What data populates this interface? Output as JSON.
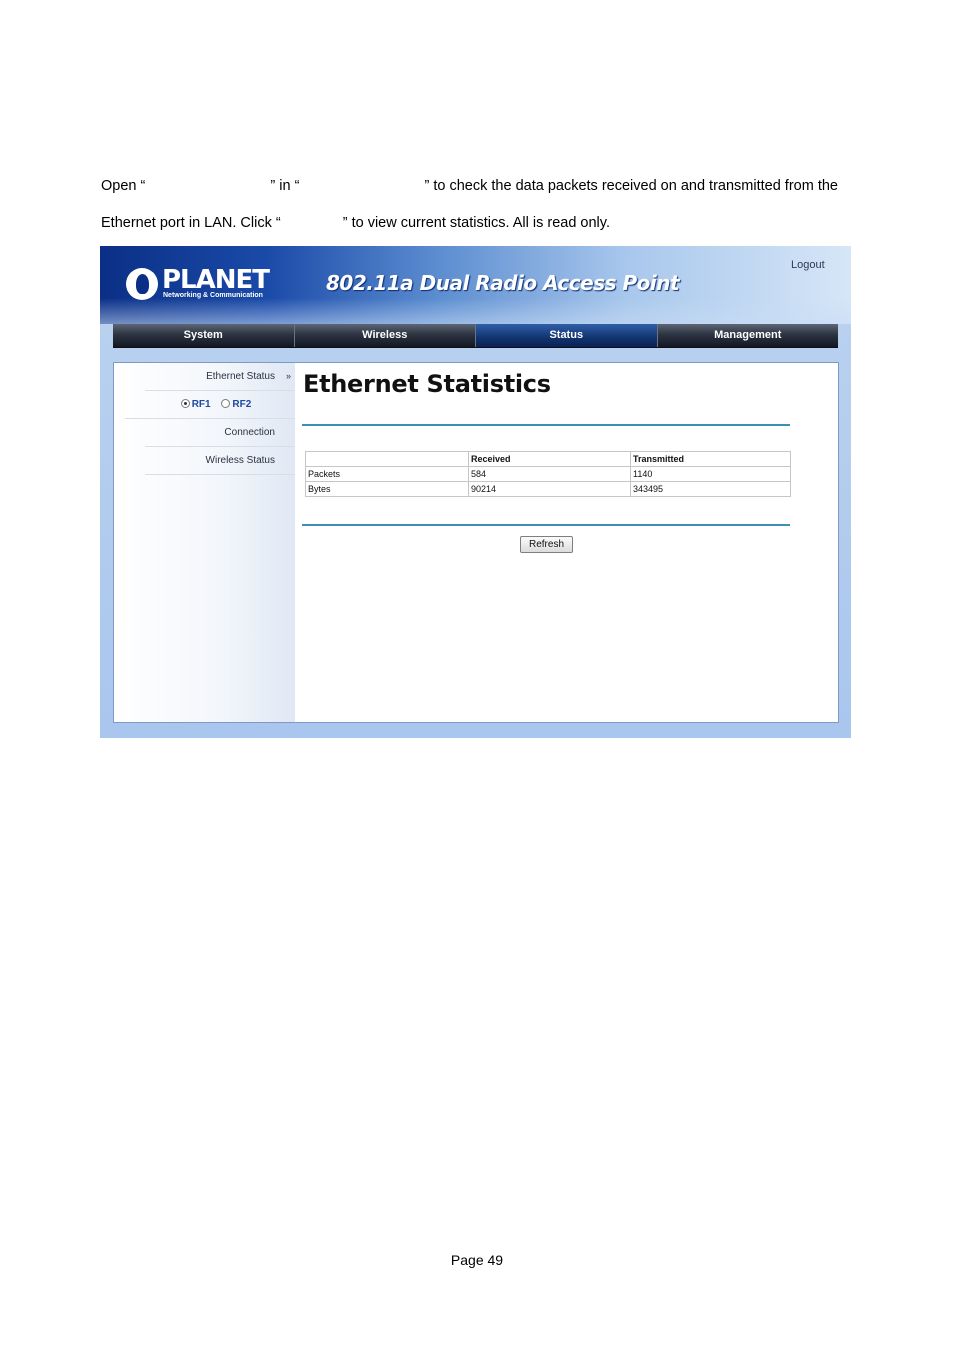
{
  "doc": {
    "line1": [
      "Open “",
      "” in “",
      "” to check the data packets received on and transmitted from the"
    ],
    "line2a": "Ethernet port in LAN. Click “",
    "line2b": "” to view current statistics. All is read only.",
    "footer": "Page 49"
  },
  "header": {
    "logo_text": "PLANET",
    "logo_sub": "Networking & Communication",
    "product": "802.11a Dual Radio Access Point",
    "logout": "Logout"
  },
  "nav": {
    "tabs": [
      "System",
      "Wireless",
      "Status",
      "Management"
    ],
    "active": "Status"
  },
  "sidebar": {
    "ethernet_status": "Ethernet Status",
    "chevron": "»",
    "rf1": "RF1",
    "rf2": "RF2",
    "rf_selected": "RF1",
    "connection": "Connection",
    "wireless_status": "Wireless Status"
  },
  "main": {
    "title": "Ethernet Statistics",
    "table": {
      "headers": [
        "",
        "Received",
        "Transmitted"
      ],
      "rows": [
        [
          "Packets",
          "584",
          "1140"
        ],
        [
          "Bytes",
          "90214",
          "343495"
        ]
      ]
    },
    "refresh_label": "Refresh"
  },
  "colors": {
    "nav_active": "#12336f",
    "rule": "#3d8fb8",
    "banner": "#0b2f86"
  }
}
